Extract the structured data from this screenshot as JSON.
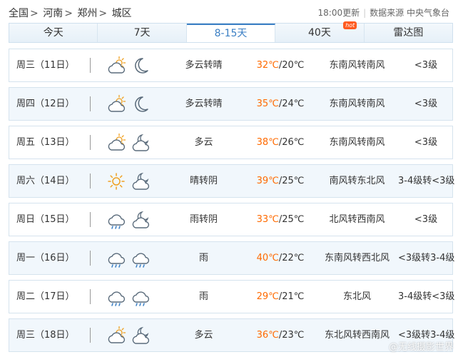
{
  "breadcrumb": [
    "全国",
    "河南",
    "郑州",
    "城区"
  ],
  "breadcrumb_sep": ">",
  "source": {
    "update": "18:00更新",
    "label": "数据来源",
    "org": "中央气象台"
  },
  "tabs": [
    {
      "label": "今天",
      "active": false
    },
    {
      "label": "7天",
      "active": false
    },
    {
      "label": "8-15天",
      "active": true
    },
    {
      "label": "40天",
      "active": false,
      "badge": "hot"
    },
    {
      "label": "雷达图",
      "active": false
    }
  ],
  "days": [
    {
      "day": "周三（11日）",
      "icons": [
        "partly-cloudy-icon",
        "moon-icon"
      ],
      "desc": "多云转晴",
      "high": "32℃",
      "low": "/20℃",
      "wind": "东南风转南风",
      "level": "<3级"
    },
    {
      "day": "周四（12日）",
      "icons": [
        "partly-cloudy-icon",
        "moon-icon"
      ],
      "desc": "多云转晴",
      "high": "35℃",
      "low": "/24℃",
      "wind": "东南风转南风",
      "level": "<3级"
    },
    {
      "day": "周五（13日）",
      "icons": [
        "partly-cloudy-icon",
        "cloudy-night-icon"
      ],
      "desc": "多云",
      "high": "38℃",
      "low": "/26℃",
      "wind": "东南风转南风",
      "level": "<3级"
    },
    {
      "day": "周六（14日）",
      "icons": [
        "sun-icon",
        "cloudy-night-icon"
      ],
      "desc": "晴转阴",
      "high": "39℃",
      "low": "/25℃",
      "wind": "南风转东北风",
      "level": "3-4级转<3级"
    },
    {
      "day": "周日（15日）",
      "icons": [
        "rain-icon",
        "cloudy-night-icon"
      ],
      "desc": "雨转阴",
      "high": "33℃",
      "low": "/25℃",
      "wind": "北风转西南风",
      "level": "<3级"
    },
    {
      "day": "周一（16日）",
      "icons": [
        "rain-icon",
        "rain-icon"
      ],
      "desc": "雨",
      "high": "40℃",
      "low": "/22℃",
      "wind": "东南风转西北风",
      "level": "<3级转3-4级"
    },
    {
      "day": "周二（17日）",
      "icons": [
        "rain-icon",
        "rain-icon"
      ],
      "desc": "雨",
      "high": "29℃",
      "low": "/21℃",
      "wind": "东北风",
      "level": "3-4级转<3级"
    },
    {
      "day": "周三（18日）",
      "icons": [
        "partly-cloudy-icon",
        "cloudy-night-icon"
      ],
      "desc": "多云",
      "high": "36℃",
      "low": "/23℃",
      "wind": "东北风转西南风",
      "level": "<3级转3-4级"
    }
  ],
  "watermark": "@无线摄影世界",
  "colors": {
    "accent": "#3b7fc4",
    "high_temp": "#ff6a00",
    "hot_badge": "#ff5a1f",
    "row_alt": "#f1f7fc"
  }
}
